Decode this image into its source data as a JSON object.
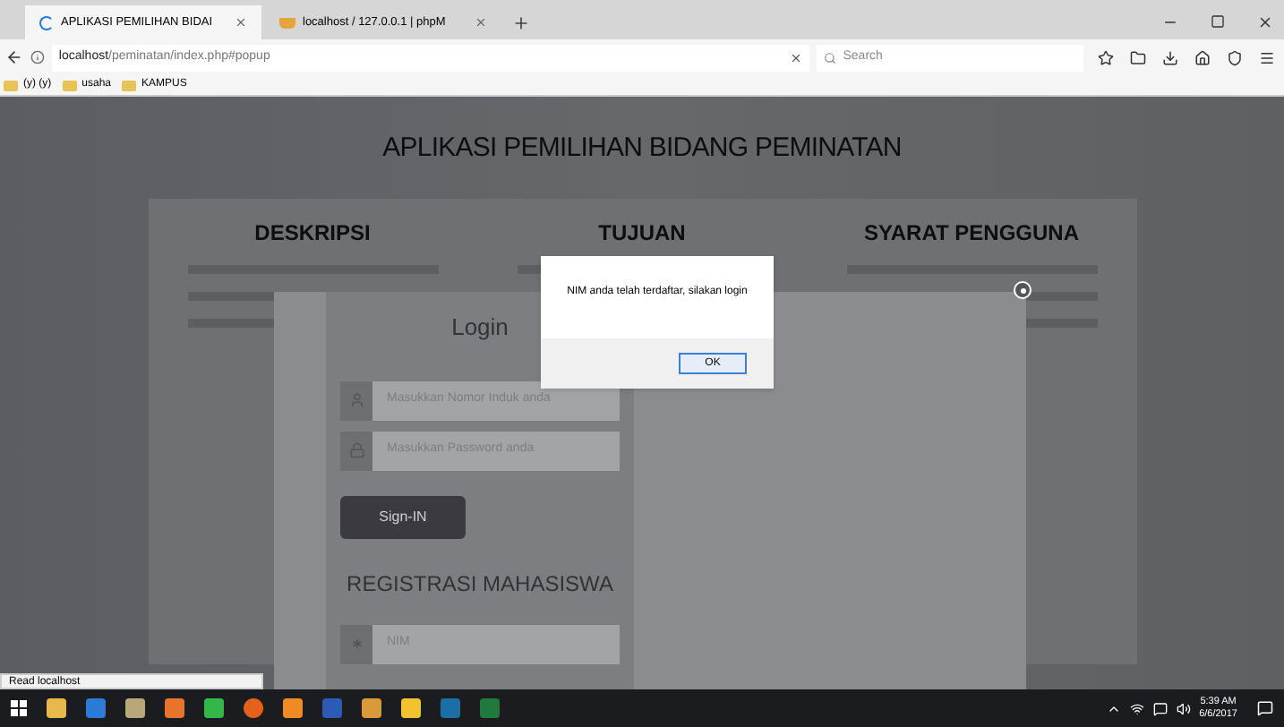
{
  "browser": {
    "tabs": [
      {
        "label": "APLIKASI PEMILIHAN BIDAI",
        "selected": true,
        "kind": "loading"
      },
      {
        "label": "localhost / 127.0.0.1 | phpM",
        "selected": false,
        "kind": "pma"
      }
    ],
    "address": {
      "host": "localhost",
      "path": "/peminatan/index.php#popup"
    },
    "search": {
      "placeholder": "Search"
    },
    "bookmarks": [
      "(y) (y)",
      "usaha",
      "KAMPUS"
    ]
  },
  "page": {
    "title": "APLIKASI PEMILIHAN BIDANG PEMINATAN",
    "columns": [
      {
        "heading": "DESKRIPSI"
      },
      {
        "heading": "TUJUAN"
      },
      {
        "heading": "SYARAT PENGGUNA"
      }
    ]
  },
  "login": {
    "title": "Login",
    "fields": [
      {
        "kind": "user",
        "placeholder": "Masukkan Nomor Induk anda"
      },
      {
        "kind": "lock",
        "placeholder": "Masukkan Password anda"
      }
    ],
    "button": "Sign-IN",
    "register_title": "REGISTRASI MAHASISWA",
    "register_fields": [
      {
        "kind": "star",
        "placeholder": "NIM"
      }
    ]
  },
  "alert": {
    "message": "NIM anda telah terdaftar, silakan login",
    "button": "OK"
  },
  "status_bar": "Read localhost",
  "taskbar": {
    "time": "5:39 AM",
    "date": "6/6/2017"
  }
}
